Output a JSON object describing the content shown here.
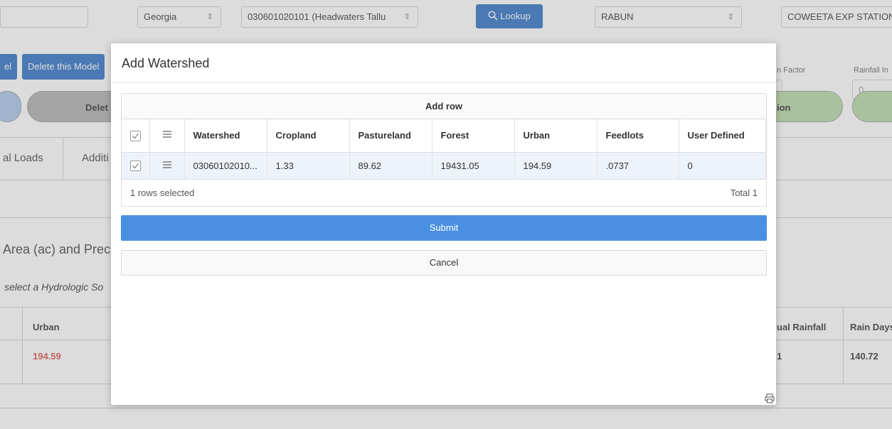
{
  "background": {
    "state_select": "Georgia",
    "huc_select": "030601020101 (Headwaters Tallu",
    "lookup_label": "Lookup",
    "county_select": "RABUN",
    "station_select": "COWEETA EXP STATION",
    "left_button": "el",
    "delete_model_label": "Delete this Model",
    "factor_label": "n Factor",
    "rainfall_label": "Rainfall In",
    "rainfall_value": "0",
    "pill_delete_label": "Delet",
    "pill_right_label": "ion",
    "tab_loads": "al Loads",
    "tab_addit": "Additi",
    "section_title": "Area (ac) and Precip",
    "hint_text": "select a Hydrologic So",
    "col_urban": "Urban",
    "val_urban": "194.59",
    "col_annual_rainfall": "ual Rainfall",
    "col_rain_days": "Rain Days",
    "val_annual_rainfall": "1",
    "val_rain_days": "140.72",
    "accent_red": "#d9534f",
    "brand_blue": "#2f72c4"
  },
  "modal": {
    "title": "Add Watershed",
    "add_row_label": "Add row",
    "columns": [
      "Watershed",
      "Cropland",
      "Pastureland",
      "Forest",
      "Urban",
      "Feedlots",
      "User Defined"
    ],
    "rows": [
      {
        "watershed": "03060102010...",
        "cropland": "1.33",
        "pastureland": "89.62",
        "forest": "19431.05",
        "urban": "194.59",
        "feedlots": ".0737",
        "user_defined": "0"
      }
    ],
    "selected_text": "1 rows selected",
    "total_text": "Total 1",
    "submit_label": "Submit",
    "cancel_label": "Cancel",
    "submit_color": "#4a90e2"
  }
}
